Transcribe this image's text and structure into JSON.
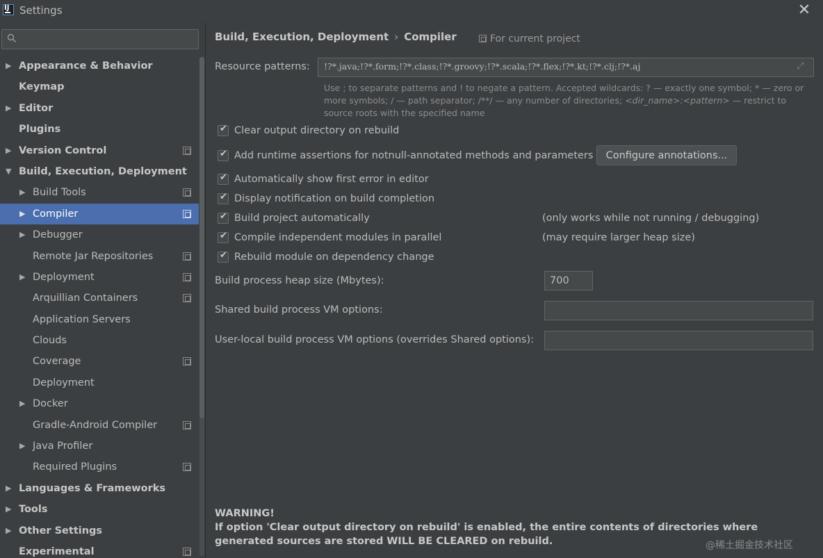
{
  "window": {
    "title": "Settings"
  },
  "search": {
    "placeholder": ""
  },
  "sidebar": {
    "items": [
      {
        "label": "Appearance & Behavior",
        "bold": true,
        "level": 0,
        "arrow": "▶",
        "project_icon": false,
        "selected": false
      },
      {
        "label": "Keymap",
        "bold": true,
        "level": 0,
        "arrow": "",
        "project_icon": false,
        "selected": false
      },
      {
        "label": "Editor",
        "bold": true,
        "level": 0,
        "arrow": "▶",
        "project_icon": false,
        "selected": false
      },
      {
        "label": "Plugins",
        "bold": true,
        "level": 0,
        "arrow": "",
        "project_icon": false,
        "selected": false
      },
      {
        "label": "Version Control",
        "bold": true,
        "level": 0,
        "arrow": "▶",
        "project_icon": true,
        "selected": false
      },
      {
        "label": "Build, Execution, Deployment",
        "bold": true,
        "level": 0,
        "arrow": "▼",
        "project_icon": false,
        "selected": false
      },
      {
        "label": "Build Tools",
        "bold": false,
        "level": 1,
        "arrow": "▶",
        "project_icon": true,
        "selected": false
      },
      {
        "label": "Compiler",
        "bold": false,
        "level": 1,
        "arrow": "▶",
        "project_icon": true,
        "selected": true
      },
      {
        "label": "Debugger",
        "bold": false,
        "level": 1,
        "arrow": "▶",
        "project_icon": false,
        "selected": false
      },
      {
        "label": "Remote Jar Repositories",
        "bold": false,
        "level": 1,
        "arrow": "",
        "project_icon": true,
        "selected": false
      },
      {
        "label": "Deployment",
        "bold": false,
        "level": 1,
        "arrow": "▶",
        "project_icon": true,
        "selected": false
      },
      {
        "label": "Arquillian Containers",
        "bold": false,
        "level": 1,
        "arrow": "",
        "project_icon": true,
        "selected": false
      },
      {
        "label": "Application Servers",
        "bold": false,
        "level": 1,
        "arrow": "",
        "project_icon": false,
        "selected": false
      },
      {
        "label": "Clouds",
        "bold": false,
        "level": 1,
        "arrow": "",
        "project_icon": false,
        "selected": false
      },
      {
        "label": "Coverage",
        "bold": false,
        "level": 1,
        "arrow": "",
        "project_icon": true,
        "selected": false
      },
      {
        "label": "Deployment",
        "bold": false,
        "level": 1,
        "arrow": "",
        "project_icon": false,
        "selected": false
      },
      {
        "label": "Docker",
        "bold": false,
        "level": 1,
        "arrow": "▶",
        "project_icon": false,
        "selected": false
      },
      {
        "label": "Gradle-Android Compiler",
        "bold": false,
        "level": 1,
        "arrow": "",
        "project_icon": true,
        "selected": false
      },
      {
        "label": "Java Profiler",
        "bold": false,
        "level": 1,
        "arrow": "▶",
        "project_icon": false,
        "selected": false
      },
      {
        "label": "Required Plugins",
        "bold": false,
        "level": 1,
        "arrow": "",
        "project_icon": true,
        "selected": false
      },
      {
        "label": "Languages & Frameworks",
        "bold": true,
        "level": 0,
        "arrow": "▶",
        "project_icon": false,
        "selected": false
      },
      {
        "label": "Tools",
        "bold": true,
        "level": 0,
        "arrow": "▶",
        "project_icon": false,
        "selected": false
      },
      {
        "label": "Other Settings",
        "bold": true,
        "level": 0,
        "arrow": "▶",
        "project_icon": false,
        "selected": false
      },
      {
        "label": "Experimental",
        "bold": true,
        "level": 0,
        "arrow": "",
        "project_icon": true,
        "selected": false
      }
    ]
  },
  "header": {
    "crumb_parent": "Build, Execution, Deployment",
    "crumb_separator": "›",
    "crumb_current": "Compiler",
    "scope": "For current project"
  },
  "compiler": {
    "resource_patterns_label": "Resource patterns:",
    "resource_patterns_value": "!?*.java;!?*.form;!?*.class;!?*.groovy;!?*.scala;!?*.flex;!?*.kt;!?*.clj;!?*.aj",
    "hint_part1": "Use ; to separate patterns and ! to negate a pattern. Accepted wildcards: ? — exactly one symbol; * — zero or more symbols; / — path separator; /**/ — any number of directories; ",
    "hint_dir_name": "<dir_name>",
    "hint_colon": ":",
    "hint_pattern": "<pattern>",
    "hint_part2": " — restrict to source roots with the specified name",
    "checkboxes": [
      {
        "label": "Clear output directory on rebuild",
        "checked": true
      },
      {
        "label": "Add runtime assertions for notnull-annotated methods and parameters",
        "checked": true
      },
      {
        "label": "Automatically show first error in editor",
        "checked": true
      },
      {
        "label": "Display notification on build completion",
        "checked": true
      },
      {
        "label": "Build project automatically",
        "checked": true
      },
      {
        "label": "Compile independent modules in parallel",
        "checked": true
      },
      {
        "label": "Rebuild module on dependency change",
        "checked": true
      }
    ],
    "configure_button": "Configure annotations...",
    "note_build_auto": "(only works while not running / debugging)",
    "note_parallel": "(may require larger heap size)",
    "heap_label": "Build process heap size (Mbytes):",
    "heap_value": "700",
    "shared_vm_label": "Shared build process VM options:",
    "shared_vm_value": "",
    "user_vm_label": "User-local build process VM options (overrides Shared options):",
    "user_vm_value": ""
  },
  "warning": {
    "title": "WARNING!",
    "text": "If option 'Clear output directory on rebuild' is enabled, the entire contents of directories where generated sources are stored WILL BE CLEARED on rebuild."
  },
  "watermark": "@稀土掘金技术社区"
}
